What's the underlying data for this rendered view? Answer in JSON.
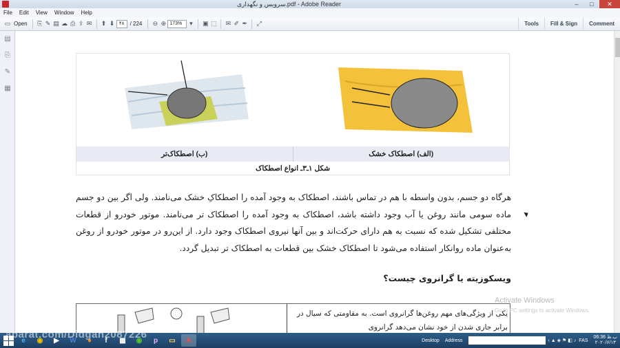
{
  "window": {
    "title": "سرویس و نگهداری.pdf - Adobe Reader",
    "controls": {
      "minimize": "–",
      "maximize": "□",
      "close": "✕"
    }
  },
  "menu": [
    "File",
    "Edit",
    "View",
    "Window",
    "Help"
  ],
  "toolbar": {
    "open_label": "Open",
    "page_current": "۴۸",
    "page_total": "/ 224",
    "zoom": "173%",
    "right_buttons": [
      "Tools",
      "Fill & Sign",
      "Comment"
    ]
  },
  "figure": {
    "caption_left": "(ب) اصطکاک‌تر",
    "caption_right": "(الف) اصطکاک خشک",
    "title": "شکل ۱ـ۳ـ انواع اصطکاک"
  },
  "body": {
    "paragraph": "هرگاه دو جسم، بدون واسطه با هم در تماس باشند، اصطکاک به وجود آمده را اصطکاکِ خشک می‌نامند. ولی اگر بین دو جسم ماده سومی مانند روغن یا آب وجود داشته باشد، اصطکاک به وجود آمده را اصطکاک تر می‌نامند. موتور خودرو از قطعات مختلفی تشکیل شده که نسبت به هم دارای حرکت‌اند و بین آنها نیروی اصطکاک وجود دارد. از این‌رو در موتور خودرو از روغن به‌عنوان ماده روانکار استفاده می‌شود تا اصطکاک خشک بین قطعات به اصطکاک تر تبدیل گردد.",
    "heading": "ویسکوزیته یا گرانروی چیست؟",
    "box_text": "یکی از ویژگی‌های مهم روغن‌ها گرانروی است. به مقاومتی که سیال در برابر جاری شدن از خود نشان می‌دهد گرانروی"
  },
  "watermark": {
    "line1": "Activate Windows",
    "line2": "Go to PC settings to activate Windows."
  },
  "taskbar": {
    "overlay_text": "aparat.com/Didgah2087226",
    "desktop_label": "Desktop",
    "address_label": "Address",
    "language": "FAS",
    "time": "ب.ظ 06:36",
    "date": "۲۰۲۰/۶/۱۳"
  }
}
